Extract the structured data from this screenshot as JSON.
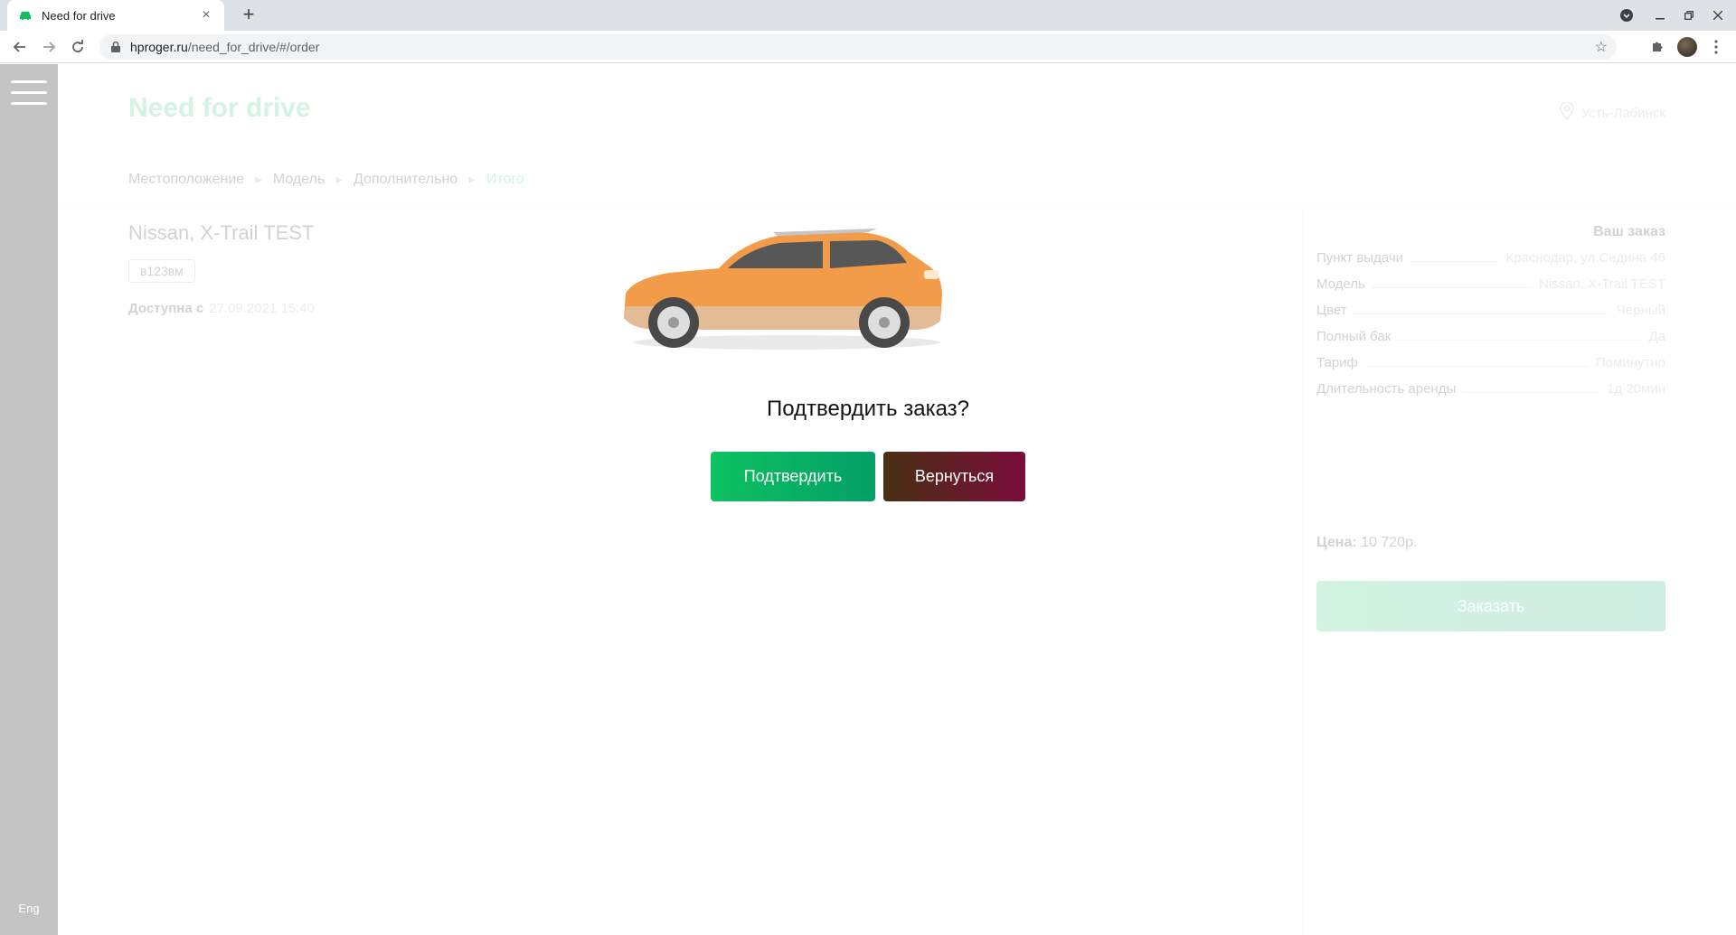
{
  "browser": {
    "tab_title": "Need for drive",
    "tab_close": "×",
    "new_tab": "+",
    "url_host": "hproger.ru",
    "url_path": "/need_for_drive/#/order"
  },
  "sidebar": {
    "lang": "Eng"
  },
  "header": {
    "brand": "Need for drive",
    "city": "Усть-Лабинск"
  },
  "breadcrumbs": {
    "items": [
      "Местоположение",
      "Модель",
      "Дополнительно",
      "Итого"
    ],
    "separator": "▶"
  },
  "car": {
    "name": "Nissan, X-Trail TEST",
    "plate": "в123вм",
    "available_label": "Доступна с",
    "available_date": "27.09.2021 15:40",
    "body_color": "#f08a2a"
  },
  "order": {
    "title": "Ваш заказ",
    "rows": [
      {
        "label": "Пункт выдачи",
        "value": "Краснодар, ул.Седина 46"
      },
      {
        "label": "Модель",
        "value": "Nissan, X-Trail TEST"
      },
      {
        "label": "Цвет",
        "value": "Черный"
      },
      {
        "label": "Полный бак",
        "value": "Да"
      },
      {
        "label": "Тариф",
        "value": "Поминутно"
      },
      {
        "label": "Длительность аренды",
        "value": "1д 20мин"
      }
    ],
    "price_label": "Цена:",
    "price_value": "10 720р.",
    "order_button": "Заказать"
  },
  "modal": {
    "question": "Подтвердить заказ?",
    "confirm": "Подтвердить",
    "back": "Вернуться"
  },
  "colors": {
    "accent": "#0ec261",
    "back_gradient_start": "#493013",
    "back_gradient_end": "#7b0c3b"
  }
}
